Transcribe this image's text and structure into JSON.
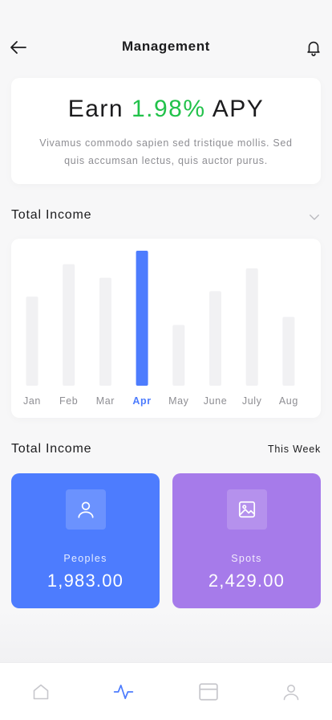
{
  "header": {
    "title": "Management",
    "back_icon": "arrow-left-icon",
    "bell_icon": "bell-icon"
  },
  "apy_card": {
    "prefix": "Earn ",
    "rate": "1.98%",
    "suffix": " APY",
    "description": "Vivamus commodo sapien sed tristique mollis. Sed quis accumsan lectus, quis auctor purus.",
    "accent_color": "#22c24b"
  },
  "income_section": {
    "title": "Total Income",
    "chevron_icon": "chevron-down-icon"
  },
  "chart_data": {
    "type": "bar",
    "categories": [
      "Jan",
      "Feb",
      "Mar",
      "Apr",
      "May",
      "June",
      "July",
      "Aug"
    ],
    "values": [
      66,
      90,
      80,
      100,
      45,
      70,
      87,
      51
    ],
    "highlighted": "Apr",
    "ylim": [
      0,
      100
    ],
    "grid": false,
    "bar_color": "#f1f1f3",
    "highlight_color": "#4d7cfe",
    "label_color": "#8e8e93"
  },
  "weekly_section": {
    "title": "Total Income",
    "period": "This Week"
  },
  "stats": [
    {
      "label": "Peoples",
      "value": "1,983.00",
      "icon": "user-icon",
      "color": "#4d7cfe"
    },
    {
      "label": "Spots",
      "value": "2,429.00",
      "icon": "image-icon",
      "color": "#a67bea"
    }
  ],
  "tabbar": {
    "items": [
      {
        "icon": "home-icon",
        "active": false
      },
      {
        "icon": "activity-icon",
        "active": true
      },
      {
        "icon": "wallet-icon",
        "active": false
      },
      {
        "icon": "profile-icon",
        "active": false
      }
    ],
    "active_color": "#4d7cfe",
    "inactive_color": "#c7c7cc"
  }
}
